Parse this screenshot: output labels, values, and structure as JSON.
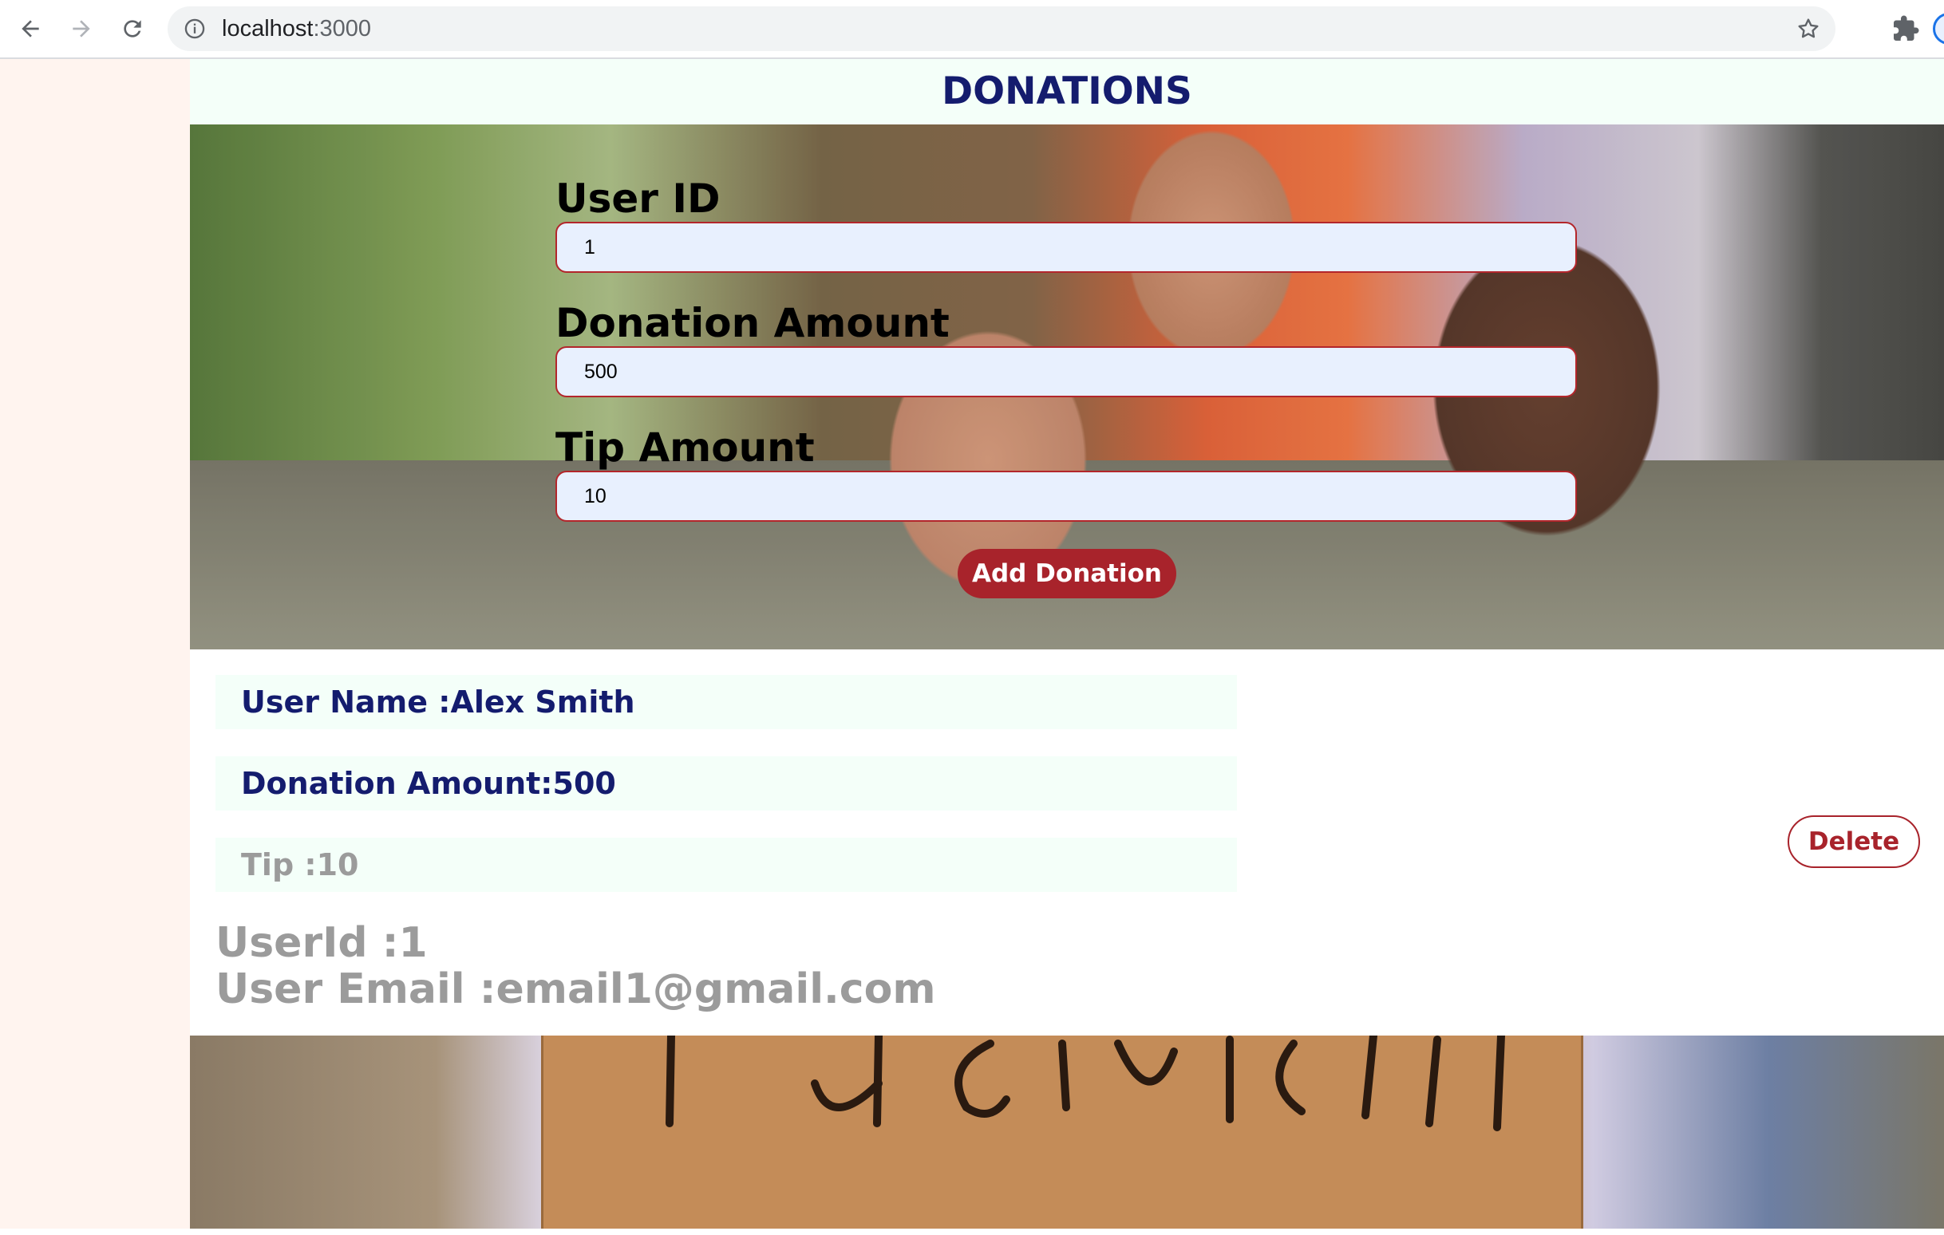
{
  "browser": {
    "url_host": "localhost",
    "url_port": ":3000"
  },
  "page": {
    "title": "DONATIONS"
  },
  "form": {
    "user_id_label": "User ID",
    "user_id_value": "1",
    "donation_amount_label": "Donation Amount",
    "donation_amount_value": "500",
    "tip_amount_label": "Tip Amount",
    "tip_amount_value": "10",
    "submit_label": "Add Donation"
  },
  "donation": {
    "user_name": "User Name :Alex Smith",
    "donation_amount": "Donation Amount:500",
    "tip": "Tip :10",
    "user_id": "UserId :1",
    "user_email": "User Email :email1@gmail.com",
    "delete_label": "Delete"
  },
  "colors": {
    "title": "#141c6e",
    "accent_red": "#a8232b",
    "input_bg": "#e8f0fe",
    "info_box_bg": "#f4fff9",
    "muted_text": "#9b9b9b",
    "left_strip": "#fff4ef"
  }
}
